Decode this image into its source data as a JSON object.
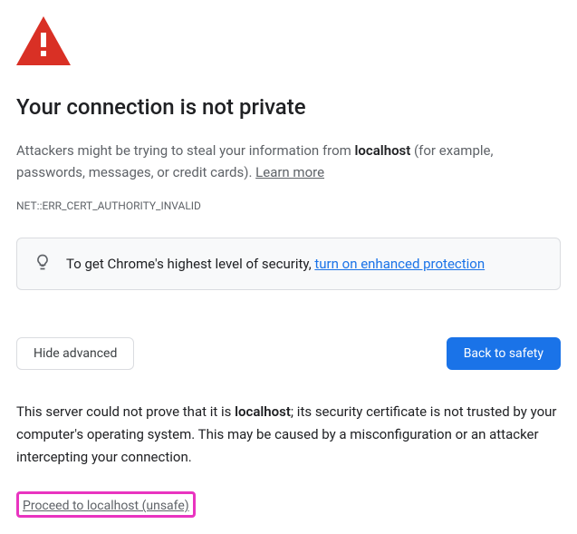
{
  "title": "Your connection is not private",
  "description_prefix": "Attackers might be trying to steal your information from ",
  "hostname": "localhost",
  "description_suffix": " (for example, passwords, messages, or credit cards). ",
  "learn_more": "Learn more",
  "error_code": "NET::ERR_CERT_AUTHORITY_INVALID",
  "tip_prefix": "To get Chrome's highest level of security, ",
  "tip_link": "turn on enhanced protection",
  "hide_advanced": "Hide advanced",
  "back_to_safety": "Back to safety",
  "advanced_prefix": "This server could not prove that it is ",
  "advanced_suffix": "; its security certificate is not trusted by your computer's operating system. This may be caused by a misconfiguration or an attacker intercepting your connection.",
  "proceed": "Proceed to localhost (unsafe)"
}
